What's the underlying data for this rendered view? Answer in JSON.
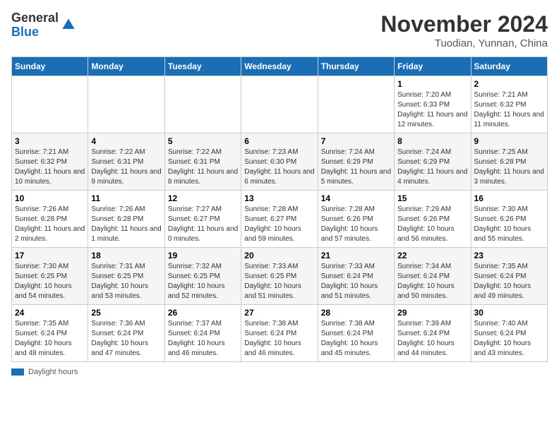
{
  "header": {
    "logo_general": "General",
    "logo_blue": "Blue",
    "month": "November 2024",
    "location": "Tuodian, Yunnan, China"
  },
  "weekdays": [
    "Sunday",
    "Monday",
    "Tuesday",
    "Wednesday",
    "Thursday",
    "Friday",
    "Saturday"
  ],
  "weeks": [
    [
      {
        "day": "",
        "info": ""
      },
      {
        "day": "",
        "info": ""
      },
      {
        "day": "",
        "info": ""
      },
      {
        "day": "",
        "info": ""
      },
      {
        "day": "",
        "info": ""
      },
      {
        "day": "1",
        "info": "Sunrise: 7:20 AM\nSunset: 6:33 PM\nDaylight: 11 hours and 12 minutes."
      },
      {
        "day": "2",
        "info": "Sunrise: 7:21 AM\nSunset: 6:32 PM\nDaylight: 11 hours and 11 minutes."
      }
    ],
    [
      {
        "day": "3",
        "info": "Sunrise: 7:21 AM\nSunset: 6:32 PM\nDaylight: 11 hours and 10 minutes."
      },
      {
        "day": "4",
        "info": "Sunrise: 7:22 AM\nSunset: 6:31 PM\nDaylight: 11 hours and 9 minutes."
      },
      {
        "day": "5",
        "info": "Sunrise: 7:22 AM\nSunset: 6:31 PM\nDaylight: 11 hours and 8 minutes."
      },
      {
        "day": "6",
        "info": "Sunrise: 7:23 AM\nSunset: 6:30 PM\nDaylight: 11 hours and 6 minutes."
      },
      {
        "day": "7",
        "info": "Sunrise: 7:24 AM\nSunset: 6:29 PM\nDaylight: 11 hours and 5 minutes."
      },
      {
        "day": "8",
        "info": "Sunrise: 7:24 AM\nSunset: 6:29 PM\nDaylight: 11 hours and 4 minutes."
      },
      {
        "day": "9",
        "info": "Sunrise: 7:25 AM\nSunset: 6:28 PM\nDaylight: 11 hours and 3 minutes."
      }
    ],
    [
      {
        "day": "10",
        "info": "Sunrise: 7:26 AM\nSunset: 6:28 PM\nDaylight: 11 hours and 2 minutes."
      },
      {
        "day": "11",
        "info": "Sunrise: 7:26 AM\nSunset: 6:28 PM\nDaylight: 11 hours and 1 minute."
      },
      {
        "day": "12",
        "info": "Sunrise: 7:27 AM\nSunset: 6:27 PM\nDaylight: 11 hours and 0 minutes."
      },
      {
        "day": "13",
        "info": "Sunrise: 7:28 AM\nSunset: 6:27 PM\nDaylight: 10 hours and 59 minutes."
      },
      {
        "day": "14",
        "info": "Sunrise: 7:28 AM\nSunset: 6:26 PM\nDaylight: 10 hours and 57 minutes."
      },
      {
        "day": "15",
        "info": "Sunrise: 7:29 AM\nSunset: 6:26 PM\nDaylight: 10 hours and 56 minutes."
      },
      {
        "day": "16",
        "info": "Sunrise: 7:30 AM\nSunset: 6:26 PM\nDaylight: 10 hours and 55 minutes."
      }
    ],
    [
      {
        "day": "17",
        "info": "Sunrise: 7:30 AM\nSunset: 6:25 PM\nDaylight: 10 hours and 54 minutes."
      },
      {
        "day": "18",
        "info": "Sunrise: 7:31 AM\nSunset: 6:25 PM\nDaylight: 10 hours and 53 minutes."
      },
      {
        "day": "19",
        "info": "Sunrise: 7:32 AM\nSunset: 6:25 PM\nDaylight: 10 hours and 52 minutes."
      },
      {
        "day": "20",
        "info": "Sunrise: 7:33 AM\nSunset: 6:25 PM\nDaylight: 10 hours and 51 minutes."
      },
      {
        "day": "21",
        "info": "Sunrise: 7:33 AM\nSunset: 6:24 PM\nDaylight: 10 hours and 51 minutes."
      },
      {
        "day": "22",
        "info": "Sunrise: 7:34 AM\nSunset: 6:24 PM\nDaylight: 10 hours and 50 minutes."
      },
      {
        "day": "23",
        "info": "Sunrise: 7:35 AM\nSunset: 6:24 PM\nDaylight: 10 hours and 49 minutes."
      }
    ],
    [
      {
        "day": "24",
        "info": "Sunrise: 7:35 AM\nSunset: 6:24 PM\nDaylight: 10 hours and 48 minutes."
      },
      {
        "day": "25",
        "info": "Sunrise: 7:36 AM\nSunset: 6:24 PM\nDaylight: 10 hours and 47 minutes."
      },
      {
        "day": "26",
        "info": "Sunrise: 7:37 AM\nSunset: 6:24 PM\nDaylight: 10 hours and 46 minutes."
      },
      {
        "day": "27",
        "info": "Sunrise: 7:38 AM\nSunset: 6:24 PM\nDaylight: 10 hours and 46 minutes."
      },
      {
        "day": "28",
        "info": "Sunrise: 7:38 AM\nSunset: 6:24 PM\nDaylight: 10 hours and 45 minutes."
      },
      {
        "day": "29",
        "info": "Sunrise: 7:39 AM\nSunset: 6:24 PM\nDaylight: 10 hours and 44 minutes."
      },
      {
        "day": "30",
        "info": "Sunrise: 7:40 AM\nSunset: 6:24 PM\nDaylight: 10 hours and 43 minutes."
      }
    ]
  ],
  "legend": {
    "daylight_label": "Daylight hours"
  }
}
